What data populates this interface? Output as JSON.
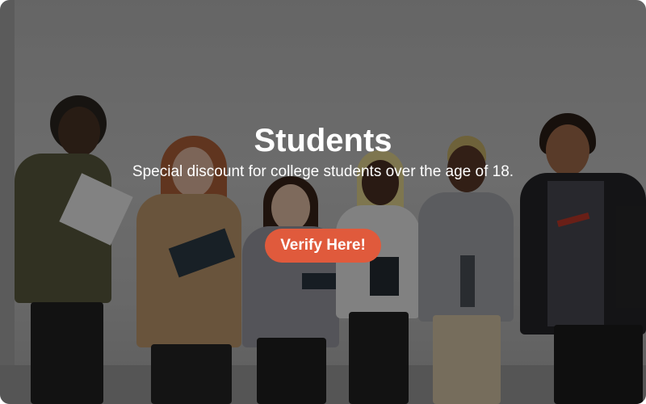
{
  "hero": {
    "title": "Students",
    "subtitle": "Special discount for college students over the age of 18.",
    "button_label": "Verify Here!"
  },
  "colors": {
    "button": "#e05a3c",
    "text": "#ffffff"
  }
}
